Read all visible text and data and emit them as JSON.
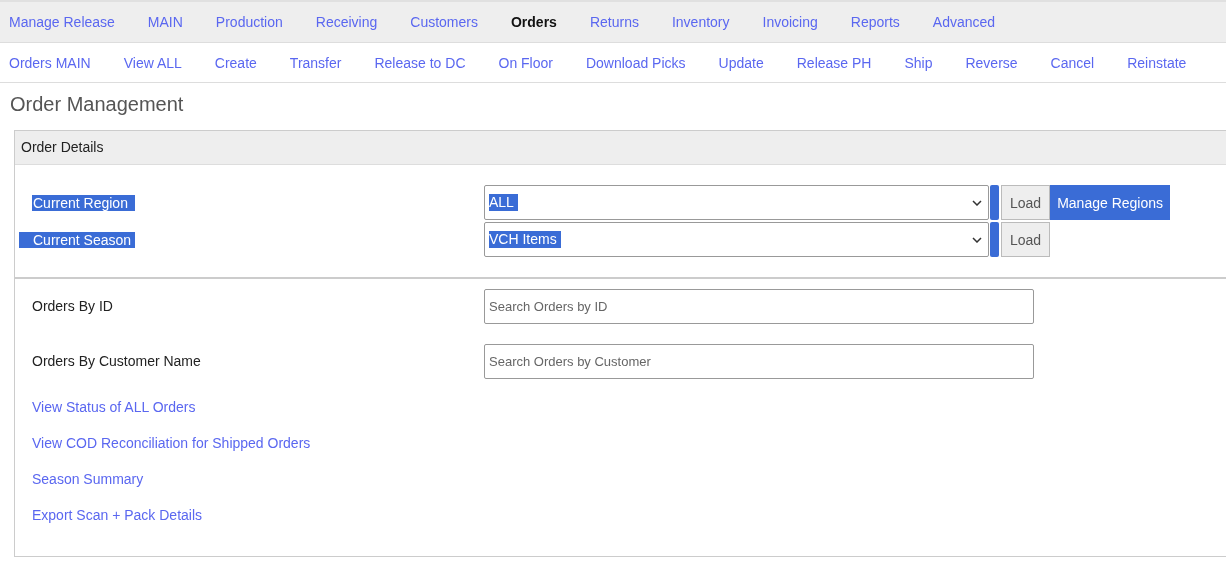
{
  "main_nav": [
    {
      "label": "Manage Release",
      "selected": false
    },
    {
      "label": "MAIN",
      "selected": false
    },
    {
      "label": "Production",
      "selected": false
    },
    {
      "label": "Receiving",
      "selected": false
    },
    {
      "label": "Customers",
      "selected": false
    },
    {
      "label": "Orders",
      "selected": true
    },
    {
      "label": "Returns",
      "selected": false
    },
    {
      "label": "Inventory",
      "selected": false
    },
    {
      "label": "Invoicing",
      "selected": false
    },
    {
      "label": "Reports",
      "selected": false
    },
    {
      "label": "Advanced",
      "selected": false
    }
  ],
  "sub_nav": [
    "Orders MAIN",
    "View ALL",
    "Create",
    "Transfer",
    "Release to DC",
    "On Floor",
    "Download Picks",
    "Update",
    "Release PH",
    "Ship",
    "Reverse",
    "Cancel",
    "Reinstate"
  ],
  "page_title": "Order Management",
  "panel": {
    "title": "Order Details",
    "selectors": [
      {
        "label": "Current Region",
        "value": "ALL",
        "highlighted": true,
        "button": "Load",
        "extra_button": "Manage Regions"
      },
      {
        "label": "Current Season",
        "value": "VCH Items",
        "highlighted": true,
        "button": "Load"
      }
    ],
    "searches": [
      {
        "label": "Orders By ID",
        "placeholder": "Search Orders by ID"
      },
      {
        "label": "Orders By Customer Name",
        "placeholder": "Search Orders by Customer"
      }
    ],
    "links": [
      "View Status of ALL Orders",
      "View COD Reconciliation for Shipped Orders",
      "Season Summary",
      "Export Scan + Pack Details"
    ]
  }
}
